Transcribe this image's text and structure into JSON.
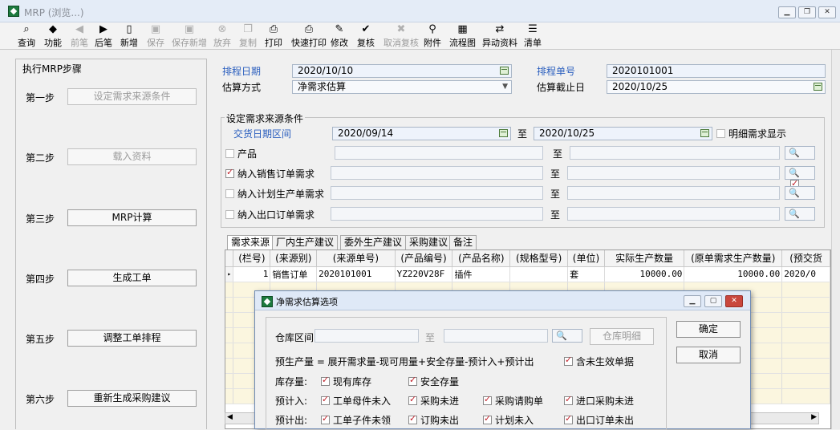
{
  "window": {
    "title": "MRP (浏览...)"
  },
  "toolbar": [
    {
      "label": "查询",
      "icon": "query-icon",
      "glyph": "⌕",
      "enabled": true
    },
    {
      "label": "功能",
      "icon": "function-icon",
      "glyph": "◆",
      "enabled": true
    },
    {
      "label": "前笔",
      "icon": "prev-arrow-icon",
      "glyph": "◀",
      "enabled": false
    },
    {
      "label": "后笔",
      "icon": "next-arrow-icon",
      "glyph": "▶",
      "enabled": true
    },
    {
      "label": "新增",
      "icon": "new-doc-icon",
      "glyph": "▯",
      "enabled": true
    },
    {
      "label": "保存",
      "icon": "save-icon",
      "glyph": "▣",
      "enabled": false
    },
    {
      "label": "保存新增",
      "icon": "save-new-icon",
      "glyph": "▣",
      "enabled": false
    },
    {
      "label": "放弃",
      "icon": "cancel-icon",
      "glyph": "⊗",
      "enabled": false
    },
    {
      "label": "复制",
      "icon": "copy-icon",
      "glyph": "❐",
      "enabled": false
    },
    {
      "label": "打印",
      "icon": "print-icon",
      "glyph": "⎙",
      "enabled": true
    },
    {
      "label": "快速打印",
      "icon": "quick-print-icon",
      "glyph": "⎙",
      "enabled": true
    },
    {
      "label": "修改",
      "icon": "edit-icon",
      "glyph": "✎",
      "enabled": true
    },
    {
      "label": "复核",
      "icon": "review-icon",
      "glyph": "✔",
      "enabled": true
    },
    {
      "label": "取消复核",
      "icon": "unreview-icon",
      "glyph": "✖",
      "enabled": false
    },
    {
      "label": "附件",
      "icon": "attachment-icon",
      "glyph": "⚲",
      "enabled": true
    },
    {
      "label": "流程图",
      "icon": "flowchart-icon",
      "glyph": "▦",
      "enabled": true
    },
    {
      "label": "异动资料",
      "icon": "change-data-icon",
      "glyph": "⇄",
      "enabled": true
    },
    {
      "label": "清单",
      "icon": "list-icon",
      "glyph": "☰",
      "enabled": true
    }
  ],
  "steps": {
    "title": "执行MRP步骤",
    "items": [
      {
        "step": "第一步",
        "button": "设定需求来源条件",
        "enabled": false
      },
      {
        "step": "第二步",
        "button": "载入资料",
        "enabled": false
      },
      {
        "step": "第三步",
        "button": "MRP计算",
        "enabled": true
      },
      {
        "step": "第四步",
        "button": "生成工单",
        "enabled": true
      },
      {
        "step": "第五步",
        "button": "调整工单排程",
        "enabled": true
      },
      {
        "step": "第六步",
        "button": "重新生成采购建议",
        "enabled": true
      }
    ]
  },
  "header": {
    "schedule_date_label": "排程日期",
    "schedule_date": "2020/10/10",
    "schedule_no_label": "排程单号",
    "schedule_no": "2020101001",
    "estimate_method_label": "估算方式",
    "estimate_method": "净需求估算",
    "estimate_end_label": "估算截止日",
    "estimate_end": "2020/10/25"
  },
  "conditions": {
    "group_title": "设定需求来源条件",
    "delivery_range_label": "交货日期区间",
    "delivery_from": "2020/09/14",
    "to_label": "至",
    "delivery_to": "2020/10/25",
    "detail_label": "明细需求显示",
    "rows": [
      {
        "label": "产品",
        "checked": false
      },
      {
        "label": "纳入销售订单需求",
        "checked": true
      },
      {
        "label": "纳入计划生产单需求",
        "checked": false
      },
      {
        "label": "纳入出口订单需求",
        "checked": false
      }
    ]
  },
  "tabs": [
    "需求来源",
    "厂内生产建议",
    "委外生产建议",
    "采购建议",
    "备注"
  ],
  "grid": {
    "columns": [
      "(栏号)",
      "(来源别)",
      "(来源单号)",
      "(产品编号)",
      "(产品名称)",
      "(规格型号)",
      "(单位)",
      "实际生产数量",
      "(原单需求生产数量)",
      "(预交货"
    ],
    "rows": [
      [
        "1",
        "销售订单",
        "2020101001",
        "YZ220V28F",
        "插件",
        "",
        "套",
        "10000.00",
        "10000.00",
        "2020/0"
      ]
    ]
  },
  "dialog": {
    "title": "净需求估算选项",
    "warehouse_label": "仓库区间",
    "to_label": "至",
    "warehouse_detail_button": "仓库明细",
    "ok_button": "确定",
    "cancel_button": "取消",
    "formula": "预生产量 = 展开需求量-现可用量+安全存量-预计入+预计出",
    "include_unapproved": "含未生效单据",
    "stock_label": "库存量:",
    "stock_items": [
      "现有库存",
      "安全存量"
    ],
    "incoming_label": "预计入:",
    "incoming_items": [
      "工单母件未入",
      "采购未进",
      "采购请购单",
      "进口采购未进"
    ],
    "outgoing_label": "预计出:",
    "outgoing_items": [
      "工单子件未领",
      "订购未出",
      "计划未入",
      "出口订单未出"
    ]
  }
}
